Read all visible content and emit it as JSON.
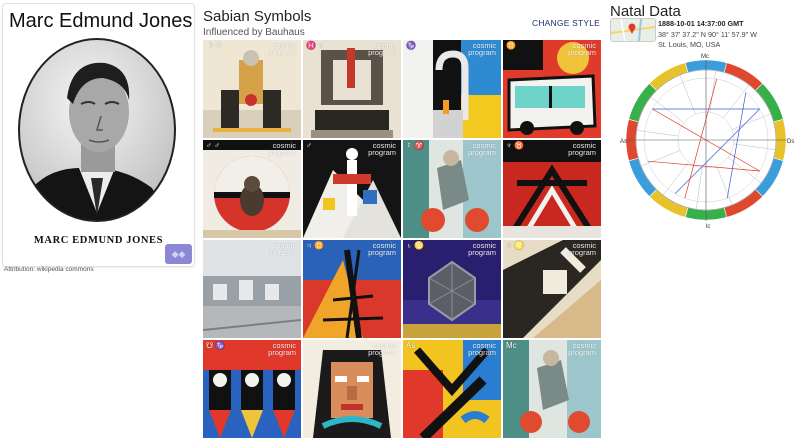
{
  "profile": {
    "name": "Marc Edmund Jones",
    "caption": "MARC EDMUND JONES",
    "attribution": "Attribution: wikipedia commons",
    "action_icon": "grid-icon"
  },
  "sabian": {
    "title": "Sabian Symbols",
    "subtitle": "Influenced by Bauhaus",
    "change_style": "CHANGE STYLE",
    "watermark_line1": "cosmic",
    "watermark_line2": "program",
    "tiles": [
      {
        "glyph": "☽ ☉"
      },
      {
        "glyph": "♓ ♀"
      },
      {
        "glyph": "♑"
      },
      {
        "glyph": "♊"
      },
      {
        "glyph": "♂ ♂"
      },
      {
        "glyph": "♂"
      },
      {
        "glyph": "☿ ♈"
      },
      {
        "glyph": "♆ ♉"
      },
      {
        "glyph": ""
      },
      {
        "glyph": "♃ ♊"
      },
      {
        "glyph": "♄ ♋"
      },
      {
        "glyph": "♅ ♌"
      },
      {
        "glyph": "☋ ♑"
      },
      {
        "glyph": ""
      },
      {
        "glyph": "As"
      },
      {
        "glyph": "Mc"
      }
    ]
  },
  "natal": {
    "title": "Natal Data",
    "datetime": "1888-10-01 14:37:00 GMT",
    "coords": "38° 37' 37.2\" N 90° 11' 57.9\" W",
    "place": "St. Louis, MO, USA",
    "wheel_labels": {
      "mc": "Mc",
      "ic": "Ic",
      "as": "As",
      "ds": "Ds"
    },
    "sign_colors": [
      "#e0472f",
      "#37b04a",
      "#e8c22a",
      "#3a9ddc"
    ]
  }
}
